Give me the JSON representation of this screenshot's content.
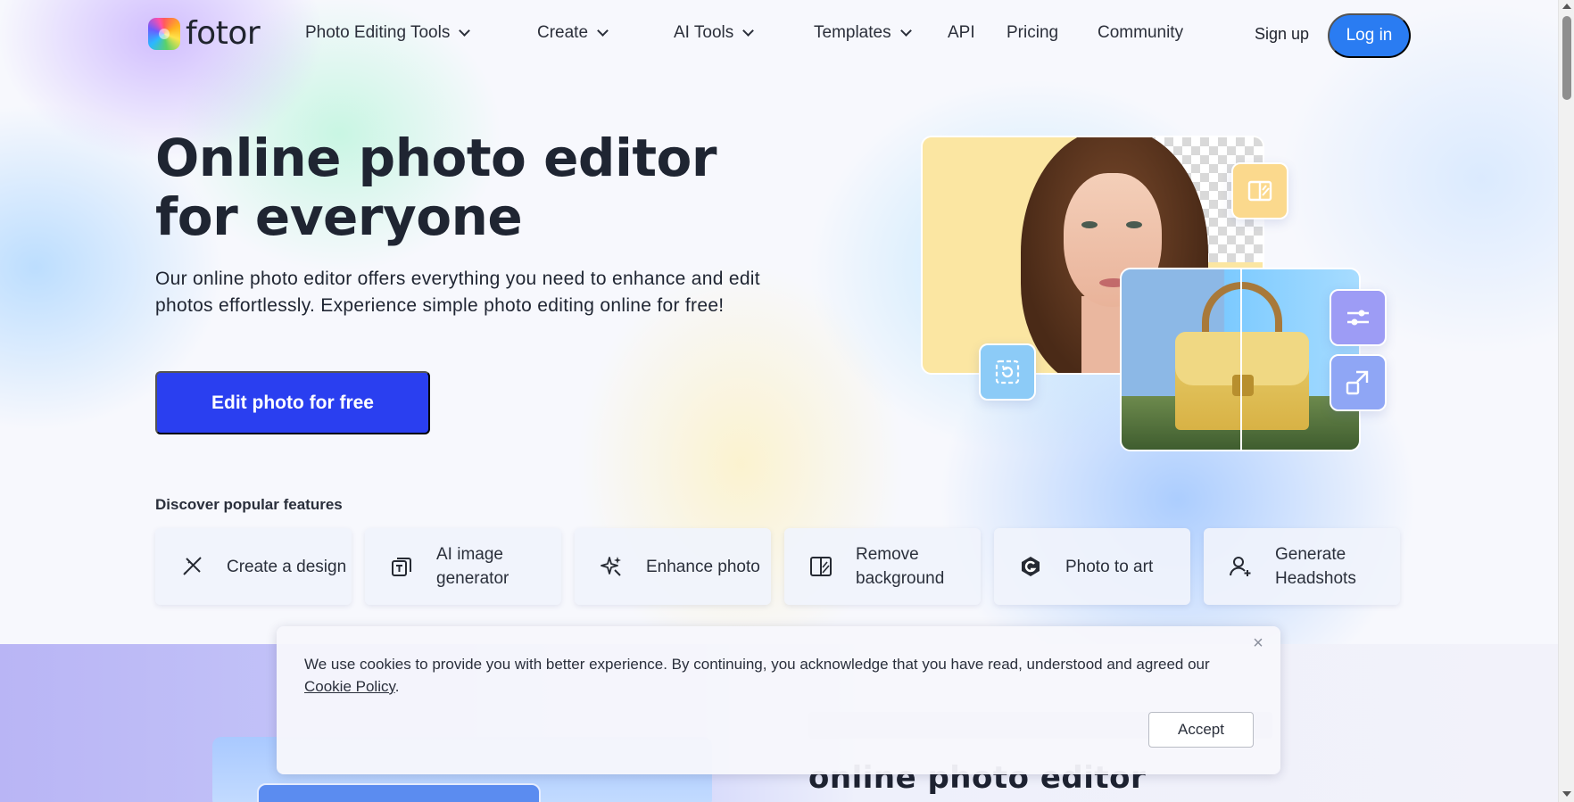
{
  "brand": {
    "name": "fotor"
  },
  "nav": {
    "items": [
      {
        "label": "Photo Editing Tools",
        "dropdown": true
      },
      {
        "label": "Create",
        "dropdown": true
      },
      {
        "label": "AI Tools",
        "dropdown": true
      },
      {
        "label": "Templates",
        "dropdown": true
      },
      {
        "label": "API",
        "dropdown": false
      },
      {
        "label": "Pricing",
        "dropdown": false
      },
      {
        "label": "Community",
        "dropdown": false
      }
    ],
    "signup_label": "Sign up",
    "login_label": "Log in"
  },
  "hero": {
    "title": "Online photo editor for everyone",
    "subtitle": "Our online photo editor offers everything you need to enhance and edit photos effortlessly. Experience simple photo editing online for free!",
    "cta_label": "Edit photo for free"
  },
  "features": {
    "heading": "Discover popular features",
    "items": [
      {
        "label": "Create a design",
        "icon": "design-tools-icon"
      },
      {
        "label": "AI image generator",
        "icon": "ai-image-icon"
      },
      {
        "label": "Enhance photo",
        "icon": "sparkle-icon"
      },
      {
        "label": "Remove background",
        "icon": "background-remover-icon"
      },
      {
        "label": "Photo to art",
        "icon": "art-icon"
      },
      {
        "label": "Generate Headshots",
        "icon": "person-add-icon"
      }
    ]
  },
  "cookie_banner": {
    "text_before_link": "We use cookies to provide you with better experience. By continuing, you acknowledge that you have read, understood and agreed our ",
    "link_label": "Cookie Policy",
    "text_after_link": ".",
    "accept_label": "Accept",
    "close_glyph": "×"
  },
  "below_fold": {
    "heading": "online photo editor"
  },
  "colors": {
    "primary": "#2a3ff0",
    "login": "#2a7cf2",
    "text": "#1f2532"
  }
}
